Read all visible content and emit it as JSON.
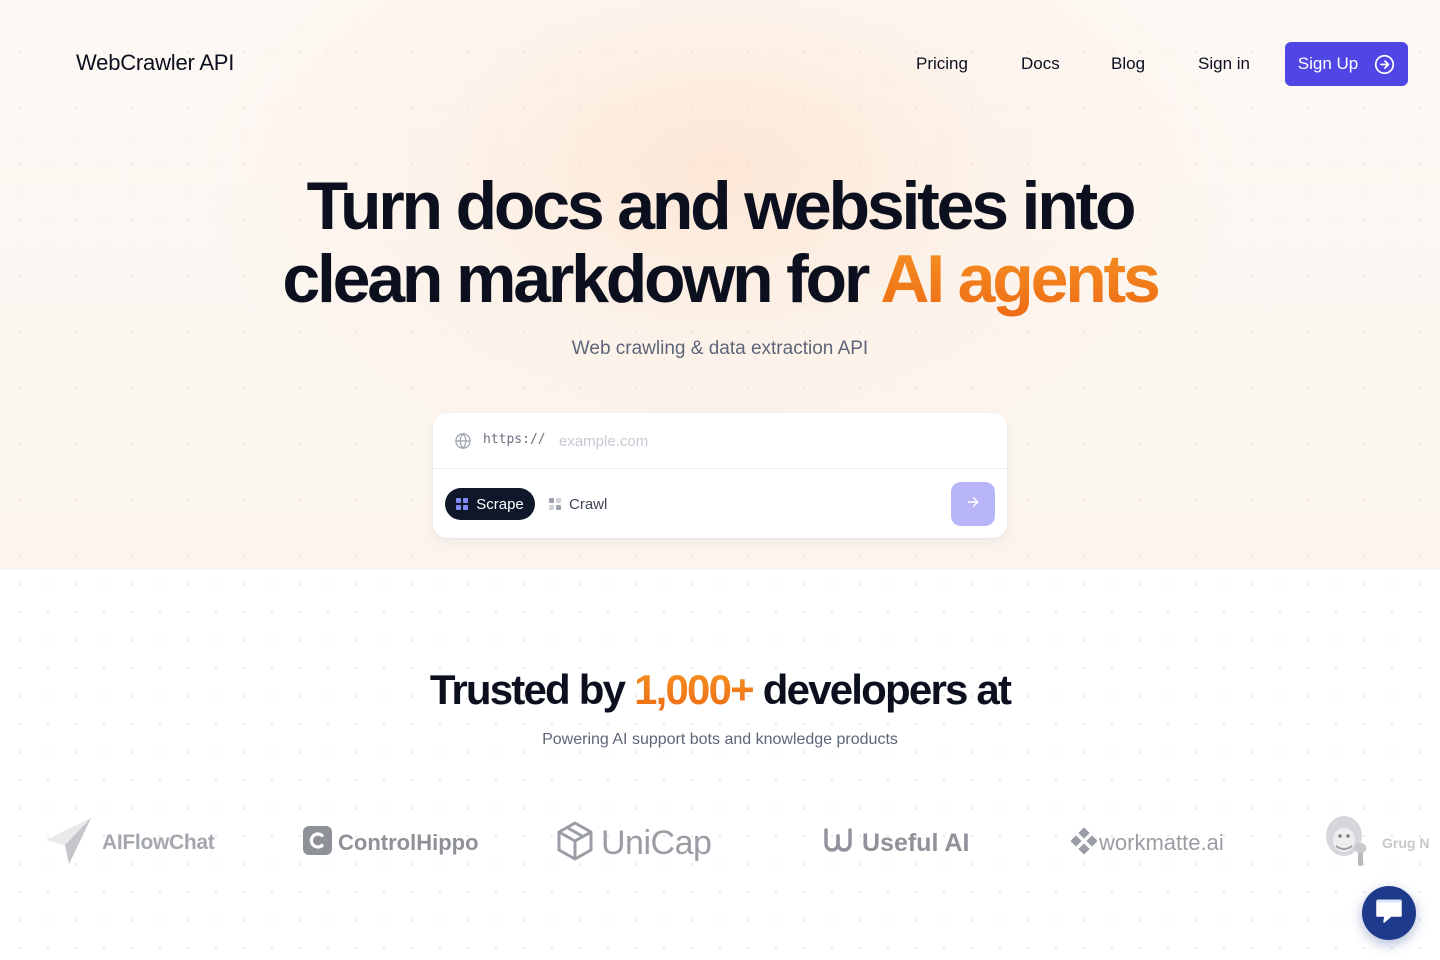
{
  "brand": {
    "name": "WebCrawler API"
  },
  "nav": {
    "links": [
      "Pricing",
      "Docs",
      "Blog",
      "Sign in"
    ],
    "signup_label": "Sign Up"
  },
  "hero": {
    "headline_line1": "Turn docs and websites into",
    "headline_line2_plain": "clean markdown for ",
    "headline_line2_accent": "AI agents",
    "subheadline": "Web crawling & data extraction API"
  },
  "url_form": {
    "prefix": "https://",
    "placeholder": "example.com",
    "value": "",
    "modes": [
      {
        "label": "Scrape",
        "selected": true
      },
      {
        "label": "Crawl",
        "selected": false
      }
    ]
  },
  "social_proof": {
    "title_before": "Trusted by ",
    "title_accent": "1,000+",
    "title_after": " developers at",
    "subtitle": "Powering AI support bots and knowledge products"
  },
  "logos": [
    {
      "name": "AIFlowChat",
      "icon": "paper-plane-icon"
    },
    {
      "name": "ControlHippo",
      "icon": "control-hippo-icon"
    },
    {
      "name": "UniCap",
      "icon": "cube-icon"
    },
    {
      "name": "Useful AI",
      "icon": "useful-ai-icon"
    },
    {
      "name": "workmatte.ai",
      "icon": "workmatte-icon"
    },
    {
      "name": "Grug N",
      "icon": "grug-caveman-icon"
    }
  ],
  "colors": {
    "accent_orange": "#f07d1c",
    "primary": "#4f46e5",
    "submit_disabled": "#b8b4f8",
    "chat": "#1e3a8a"
  }
}
